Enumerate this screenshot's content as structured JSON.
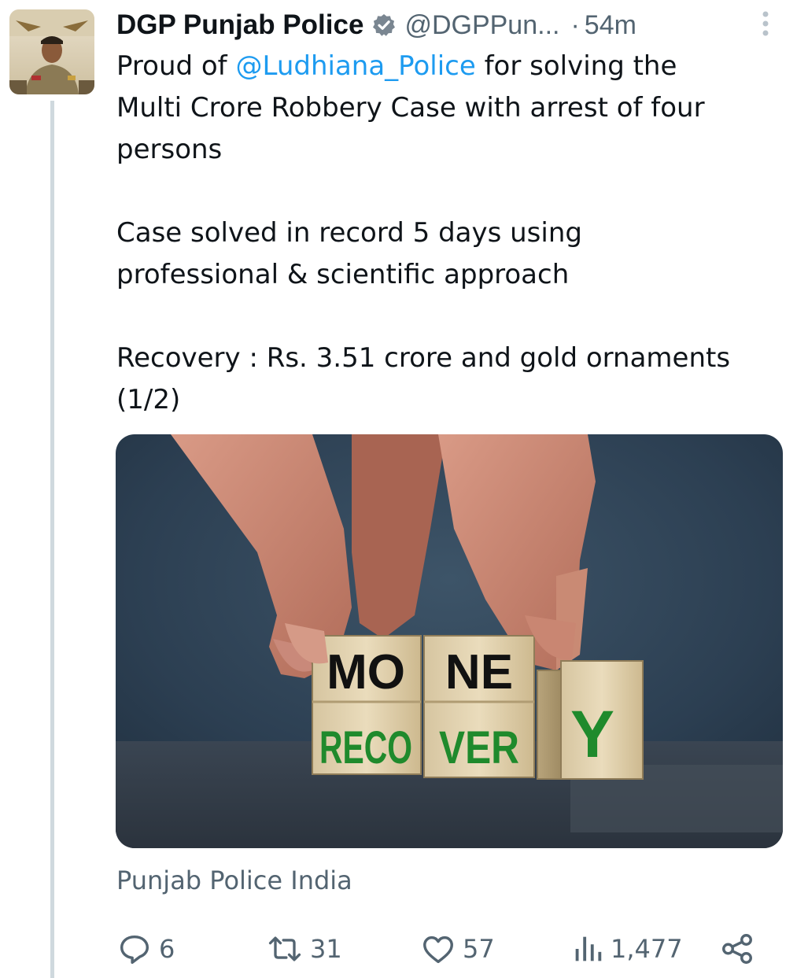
{
  "tweet": {
    "author_name": "DGP Punjab Police",
    "handle": "@DGPPun...",
    "separator": "·",
    "time": "54m",
    "text_before_mention": "Proud of ",
    "mention": "@Ludhiana_Police",
    "text_after_mention": " for solving the\nMulti Crore Robbery Case with arrest of four\npersons\n\nCase solved in record 5 days using\nprofessional & scientific approach\n\nRecovery : Rs. 3.51 crore and gold ornaments\n(1/2)",
    "media": {
      "top_blocks": [
        "MO",
        "NE"
      ],
      "bottom_blocks": [
        "RECO",
        "VER"
      ],
      "last_block": "Y"
    },
    "source": "Punjab Police India",
    "stats": {
      "replies": "6",
      "reposts": "31",
      "likes": "57",
      "views": "1,477"
    }
  },
  "icons": {
    "verified": "verified-badge-icon",
    "more": "more-options-icon",
    "reply": "reply-icon",
    "repost": "repost-icon",
    "like": "heart-icon",
    "views": "views-chart-icon",
    "share": "share-icon"
  },
  "colors": {
    "text": "#0f1419",
    "secondary": "#536471",
    "link": "#1d9bf0",
    "thread_line": "#cfd9de",
    "recovery_green": "#1f8a2c"
  }
}
